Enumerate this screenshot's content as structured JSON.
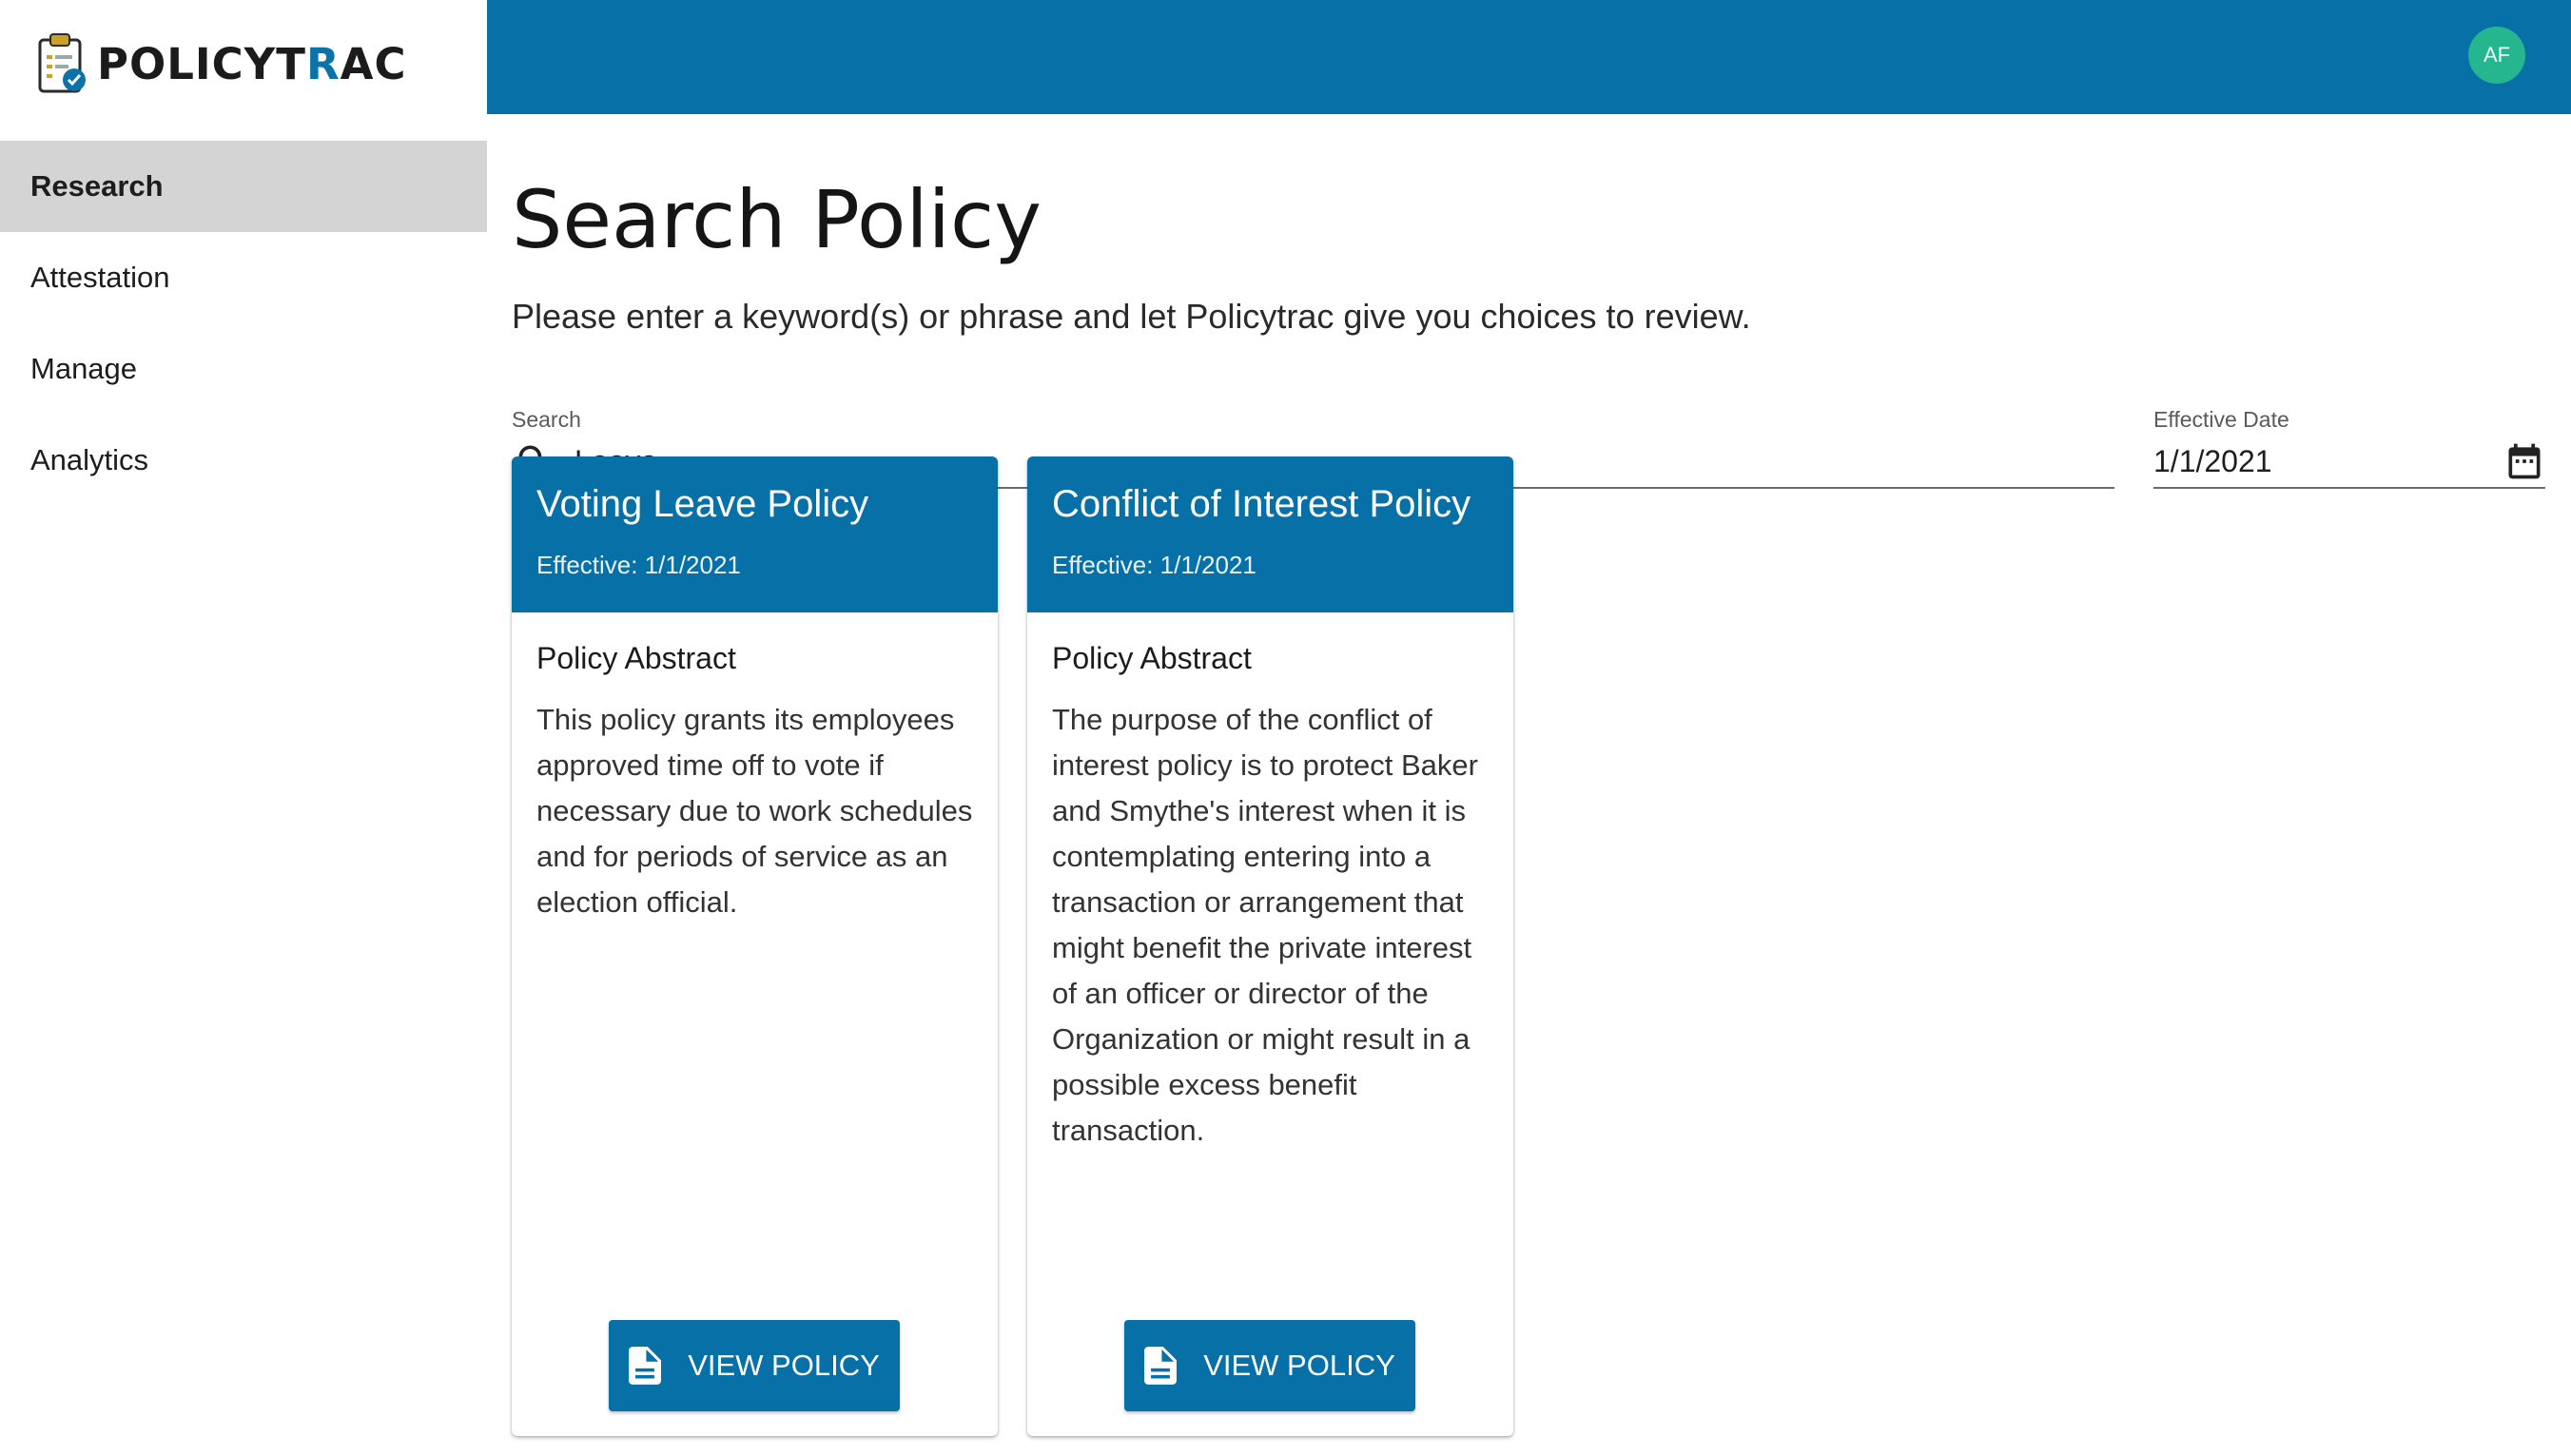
{
  "app": {
    "logo_text_main": "POLICYT",
    "logo_text_accent": "R",
    "logo_text_end": "AC"
  },
  "topbar": {
    "avatar_initials": "AF",
    "avatar_color": "#25b58f",
    "brand_color": "#0670a7"
  },
  "sidebar": {
    "items": [
      {
        "label": "Research",
        "active": true
      },
      {
        "label": "Attestation",
        "active": false
      },
      {
        "label": "Manage",
        "active": false
      },
      {
        "label": "Analytics",
        "active": false
      }
    ]
  },
  "main": {
    "title": "Search Policy",
    "subtitle": "Please enter a keyword(s) or phrase and let Policytrac give you choices to review.",
    "search": {
      "label": "Search",
      "value": "Leave",
      "icon": "search-icon"
    },
    "effective_date": {
      "label": "Effective Date",
      "value": "1/1/2021",
      "icon": "calendar-icon"
    }
  },
  "cards": [
    {
      "title": "Voting Leave Policy",
      "effective": "Effective: 1/1/2021",
      "abstract_label": "Policy Abstract",
      "abstract": "This policy grants its employees approved time off to vote if necessary due to work schedules and for periods of service as an election official.",
      "button_label": "VIEW POLICY"
    },
    {
      "title": "Conflict of Interest Policy",
      "effective": "Effective: 1/1/2021",
      "abstract_label": "Policy Abstract",
      "abstract": "The purpose of the conflict of interest policy is to protect Baker and Smythe's interest when it is contemplating entering into a transaction or arrangement that might benefit the private interest of an officer or director of the Organization or might result in a possible excess benefit transaction.",
      "button_label": "VIEW POLICY"
    }
  ]
}
